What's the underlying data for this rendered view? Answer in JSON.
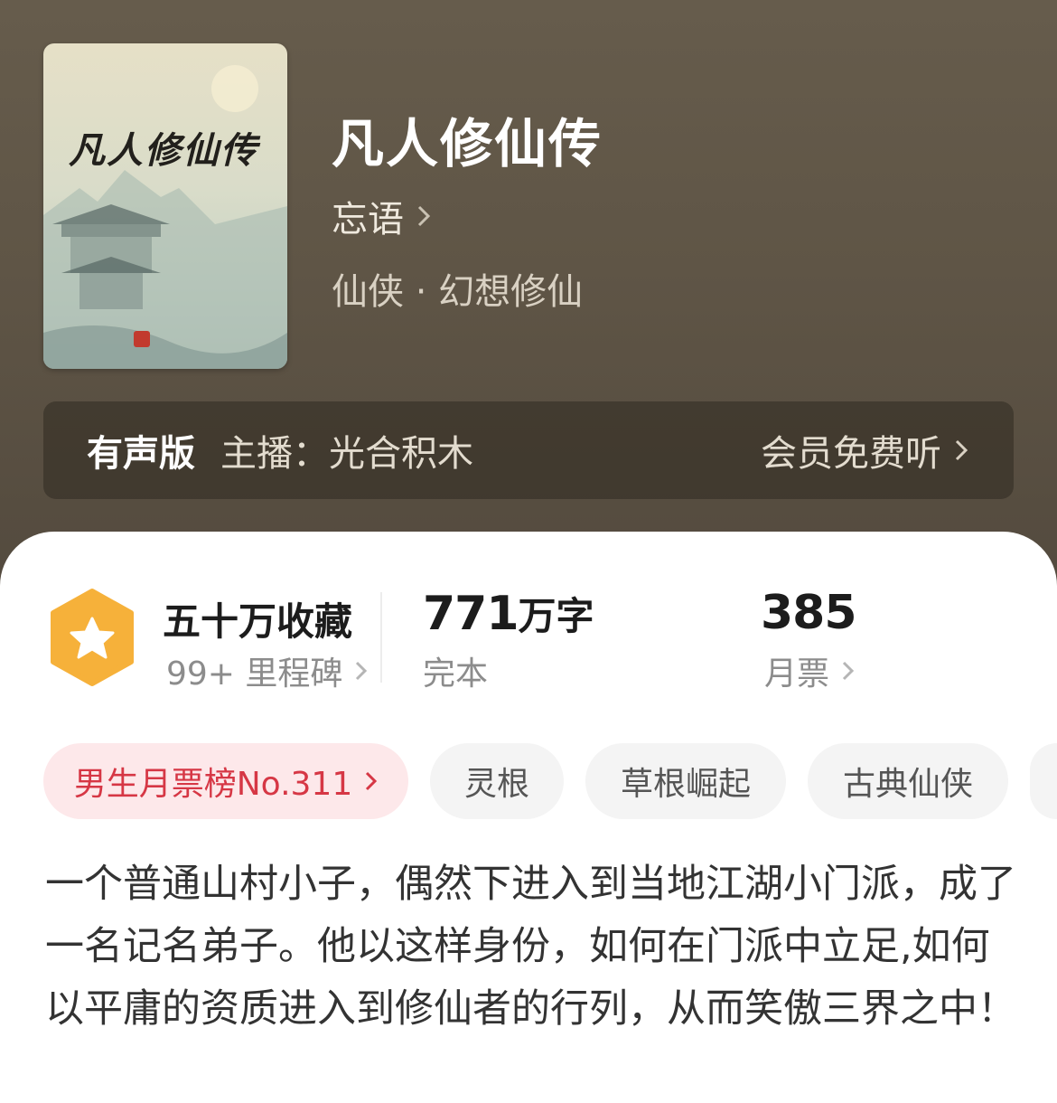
{
  "book": {
    "cover_title": "凡人修仙传",
    "title": "凡人修仙传",
    "author": "忘语",
    "genre": "仙侠 · 幻想修仙"
  },
  "audio": {
    "label": "有声版",
    "host": "主播：光合积木",
    "cta": "会员免费听"
  },
  "stats": {
    "collect_title": "五十万收藏",
    "milestone": "99+ 里程碑",
    "words_num": "771",
    "words_unit": "万字",
    "status": "完本",
    "tickets_num": "385",
    "tickets_label": "月票"
  },
  "tags": [
    "男生月票榜No.311",
    "灵根",
    "草根崛起",
    "古典仙侠"
  ],
  "description": "一个普通山村小子，偶然下进入到当地江湖小门派，成了一名记名弟子。他以这样身份，如何在门派中立足,如何以平庸的资质进入到修仙者的行列，从而笑傲三界之中！",
  "icons": {
    "badge": "star-hexagon-icon",
    "chevron": "chevron-right-icon"
  },
  "colors": {
    "hero_bg": "#5f5546",
    "badge": "#f6b13a",
    "rank_tag_bg": "#fde8ea",
    "rank_tag_text": "#d63745"
  }
}
